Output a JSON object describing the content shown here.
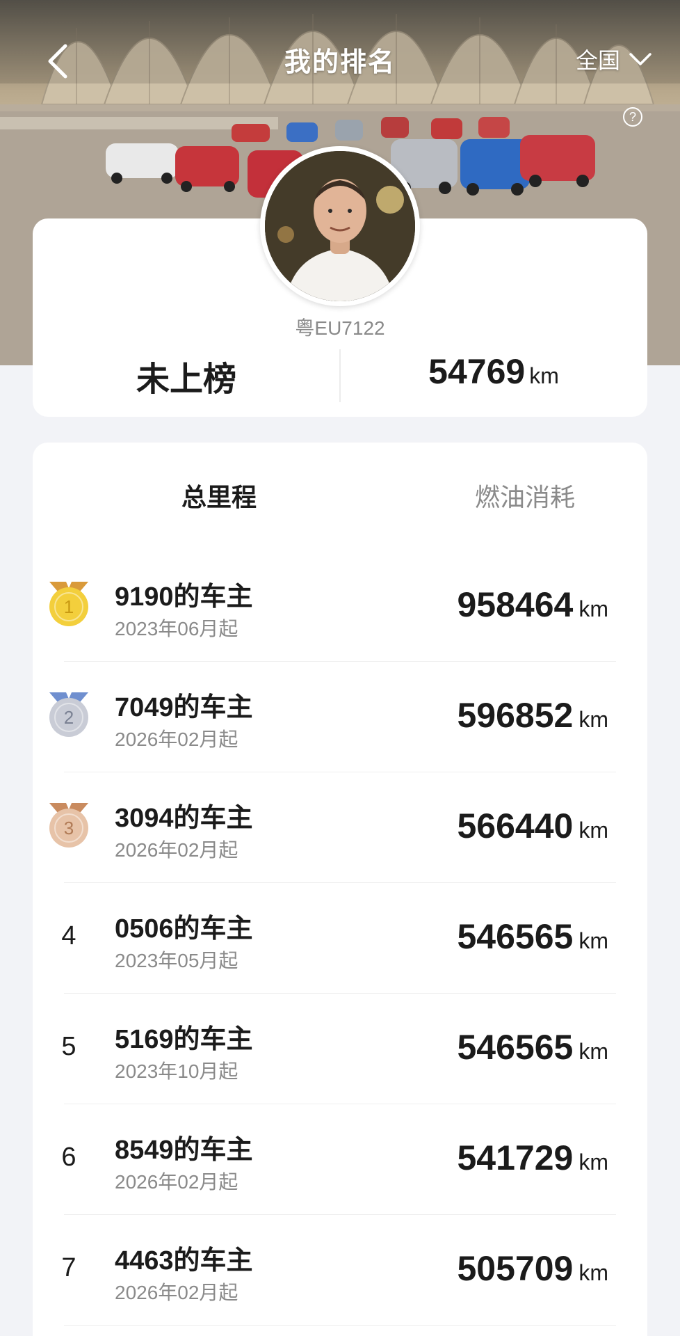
{
  "header": {
    "title": "我的排名",
    "region": "全国",
    "back_icon": "chevron-left-icon",
    "region_icon": "chevron-down-icon",
    "help_icon": "question-circle-icon",
    "help_glyph": "?"
  },
  "profile": {
    "plate": "粤EU7122",
    "rank_status": "未上榜",
    "mileage": "54769",
    "unit": "km"
  },
  "tabs": [
    {
      "label": "总里程",
      "active": true
    },
    {
      "label": "燃油消耗",
      "active": false
    }
  ],
  "ranking": [
    {
      "rank": "1",
      "medal": "gold",
      "name": "9190的车主",
      "since": "2023年06月起",
      "mileage": "958464",
      "unit": "km"
    },
    {
      "rank": "2",
      "medal": "silver",
      "name": "7049的车主",
      "since": "2026年02月起",
      "mileage": "596852",
      "unit": "km"
    },
    {
      "rank": "3",
      "medal": "bronze",
      "name": "3094的车主",
      "since": "2026年02月起",
      "mileage": "566440",
      "unit": "km"
    },
    {
      "rank": "4",
      "medal": "",
      "name": "0506的车主",
      "since": "2023年05月起",
      "mileage": "546565",
      "unit": "km"
    },
    {
      "rank": "5",
      "medal": "",
      "name": "5169的车主",
      "since": "2023年10月起",
      "mileage": "546565",
      "unit": "km"
    },
    {
      "rank": "6",
      "medal": "",
      "name": "8549的车主",
      "since": "2026年02月起",
      "mileage": "541729",
      "unit": "km"
    },
    {
      "rank": "7",
      "medal": "",
      "name": "4463的车主",
      "since": "2026年02月起",
      "mileage": "505709",
      "unit": "km"
    }
  ],
  "colors": {
    "gold": "#f3cf3c",
    "gold_ribbon": "#d99a3a",
    "silver": "#c9ccd6",
    "silver_ribbon": "#6f8fcf",
    "bronze": "#e7c3a8",
    "bronze_ribbon": "#c98b5f",
    "page_bg": "#f2f3f7"
  }
}
